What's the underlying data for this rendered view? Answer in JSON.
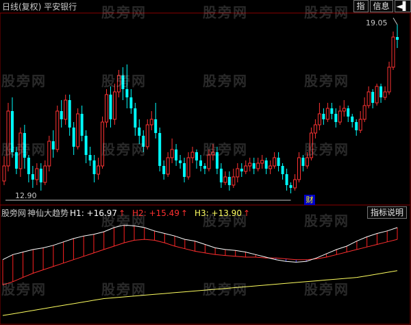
{
  "header": {
    "title": "日线(复权)  平安银行",
    "buttons": [
      "指",
      "信息"
    ],
    "window_icon": "pin-close-icon"
  },
  "watermark": "股旁网",
  "price_chart": {
    "high_label": "19.05",
    "low_label": "12.90",
    "badge": "财",
    "up_color": "#ff3333",
    "down_color": "#00ffff",
    "candles": [
      [
        13.35,
        13.9,
        13.2,
        14.25
      ],
      [
        13.9,
        15.9,
        13.7,
        16.2
      ],
      [
        15.9,
        14.4,
        14.2,
        16.4
      ],
      [
        14.4,
        13.8,
        13.6,
        14.6
      ],
      [
        13.8,
        15.1,
        13.5,
        15.3
      ],
      [
        15.1,
        14.2,
        13.8,
        15.4
      ],
      [
        14.2,
        13.6,
        13.3,
        14.3
      ],
      [
        13.6,
        13.4,
        13.1,
        13.9
      ],
      [
        13.4,
        13.8,
        13.2,
        14.0
      ],
      [
        13.8,
        13.3,
        13.0,
        14.0
      ],
      [
        13.3,
        13.9,
        13.2,
        14.1
      ],
      [
        13.9,
        14.8,
        13.7,
        15.0
      ],
      [
        14.8,
        14.5,
        14.2,
        15.2
      ],
      [
        14.5,
        15.9,
        14.4,
        16.1
      ],
      [
        15.9,
        15.6,
        15.3,
        16.3
      ],
      [
        15.6,
        16.3,
        15.4,
        16.5
      ],
      [
        16.3,
        15.3,
        15.0,
        16.5
      ],
      [
        15.3,
        14.6,
        14.3,
        15.5
      ],
      [
        14.6,
        15.8,
        14.5,
        16.0
      ],
      [
        15.8,
        15.0,
        14.8,
        16.1
      ],
      [
        15.0,
        14.3,
        14.0,
        15.2
      ],
      [
        14.3,
        14.1,
        13.9,
        14.6
      ],
      [
        14.1,
        13.6,
        13.3,
        14.3
      ],
      [
        13.6,
        13.9,
        13.4,
        14.2
      ],
      [
        13.9,
        15.5,
        13.8,
        15.7
      ],
      [
        15.5,
        16.5,
        15.3,
        16.7
      ],
      [
        16.5,
        15.6,
        15.3,
        16.8
      ],
      [
        15.6,
        16.6,
        15.4,
        16.9
      ],
      [
        16.6,
        17.2,
        16.4,
        17.4
      ],
      [
        17.2,
        16.7,
        16.3,
        17.5
      ],
      [
        16.7,
        16.4,
        16.0,
        17.6
      ],
      [
        16.4,
        16.0,
        15.8,
        16.7
      ],
      [
        16.0,
        15.3,
        15.0,
        16.2
      ],
      [
        15.3,
        15.0,
        14.7,
        15.6
      ],
      [
        15.0,
        14.6,
        14.4,
        15.2
      ],
      [
        14.6,
        15.4,
        14.5,
        15.6
      ],
      [
        15.4,
        15.6,
        15.2,
        15.9
      ],
      [
        15.6,
        15.1,
        14.9,
        16.2
      ],
      [
        15.1,
        13.9,
        13.7,
        15.3
      ],
      [
        13.9,
        13.6,
        13.4,
        14.1
      ],
      [
        13.6,
        14.2,
        13.5,
        14.4
      ],
      [
        14.2,
        14.5,
        14.0,
        14.9
      ],
      [
        14.5,
        14.1,
        13.9,
        14.7
      ],
      [
        14.1,
        14.0,
        13.8,
        14.3
      ],
      [
        14.0,
        13.5,
        13.3,
        14.2
      ],
      [
        13.5,
        14.2,
        13.4,
        14.4
      ],
      [
        14.2,
        14.4,
        14.0,
        14.6
      ],
      [
        14.4,
        14.1,
        13.8,
        14.5
      ],
      [
        14.1,
        13.9,
        13.7,
        14.3
      ],
      [
        13.9,
        13.8,
        13.6,
        14.0
      ],
      [
        13.8,
        14.3,
        13.7,
        14.5
      ],
      [
        14.3,
        14.4,
        14.1,
        14.7
      ],
      [
        14.4,
        13.8,
        13.6,
        14.6
      ],
      [
        13.8,
        13.3,
        13.1,
        14.0
      ],
      [
        13.3,
        13.5,
        13.2,
        13.7
      ],
      [
        13.5,
        13.2,
        13.0,
        13.7
      ],
      [
        13.2,
        13.5,
        13.1,
        13.8
      ],
      [
        13.5,
        13.8,
        13.3,
        14.0
      ],
      [
        13.8,
        13.7,
        13.5,
        14.0
      ],
      [
        13.7,
        13.9,
        13.6,
        14.1
      ],
      [
        13.9,
        14.0,
        13.7,
        14.2
      ],
      [
        14.0,
        13.8,
        13.6,
        14.2
      ],
      [
        13.8,
        14.0,
        13.7,
        14.2
      ],
      [
        14.0,
        14.1,
        13.8,
        14.3
      ],
      [
        14.1,
        13.8,
        13.6,
        14.2
      ],
      [
        13.8,
        13.9,
        13.6,
        14.1
      ],
      [
        13.9,
        14.2,
        13.8,
        14.4
      ],
      [
        14.2,
        13.9,
        13.7,
        14.4
      ],
      [
        13.9,
        13.6,
        13.4,
        14.0
      ],
      [
        13.6,
        13.2,
        13.0,
        13.8
      ],
      [
        13.2,
        13.1,
        12.9,
        13.3
      ],
      [
        13.1,
        13.4,
        13.0,
        13.6
      ],
      [
        13.4,
        14.2,
        13.3,
        14.4
      ],
      [
        14.2,
        13.9,
        13.7,
        14.3
      ],
      [
        13.9,
        14.2,
        13.8,
        14.4
      ],
      [
        14.2,
        15.1,
        14.1,
        15.3
      ],
      [
        15.1,
        15.4,
        14.9,
        15.6
      ],
      [
        15.4,
        15.8,
        15.2,
        16.2
      ],
      [
        15.8,
        15.6,
        15.4,
        16.0
      ],
      [
        15.6,
        16.0,
        15.5,
        16.2
      ],
      [
        16.0,
        15.8,
        15.6,
        16.2
      ],
      [
        15.8,
        15.5,
        15.3,
        16.0
      ],
      [
        15.5,
        15.9,
        15.4,
        16.1
      ],
      [
        15.9,
        16.0,
        15.7,
        16.3
      ],
      [
        16.0,
        15.7,
        15.5,
        16.1
      ],
      [
        15.7,
        15.5,
        15.3,
        15.8
      ],
      [
        15.5,
        15.2,
        15.0,
        15.6
      ],
      [
        15.2,
        15.6,
        15.1,
        15.9
      ],
      [
        15.6,
        16.1,
        15.5,
        16.4
      ],
      [
        16.1,
        16.6,
        16.0,
        16.8
      ],
      [
        16.6,
        16.2,
        16.0,
        16.7
      ],
      [
        16.2,
        16.8,
        16.1,
        16.9
      ],
      [
        16.8,
        16.4,
        16.2,
        16.9
      ],
      [
        16.4,
        16.6,
        16.3,
        16.8
      ],
      [
        16.6,
        17.5,
        16.5,
        17.7
      ],
      [
        17.5,
        18.6,
        17.4,
        18.8
      ],
      [
        18.6,
        18.5,
        18.2,
        19.05
      ]
    ]
  },
  "indicator": {
    "name": "神仙大趋势",
    "h1_label": "H1: +16.97",
    "h2_label": "H2: +15.49",
    "h3_label": "H3: +13.90",
    "arrow": "↑",
    "explain_button": "指标说明",
    "h1_color": "#ffffff",
    "h2_color": "#ff3030",
    "h3_color": "#ffff60",
    "h1": [
      16.3,
      16.6,
      16.75,
      16.9,
      17.0,
      17.15,
      17.35,
      17.55,
      17.7,
      17.8,
      17.95,
      18.2,
      18.35,
      18.3,
      18.2,
      18.0,
      17.85,
      17.7,
      17.5,
      17.4,
      17.2,
      17.0,
      16.9,
      16.85,
      16.75,
      16.6,
      16.45,
      16.3,
      16.2,
      16.15,
      16.2,
      16.4,
      16.65,
      16.9,
      17.1,
      17.4,
      17.65,
      17.85,
      18.0,
      18.2
    ],
    "h2": [
      14.8,
      15.0,
      15.25,
      15.5,
      15.7,
      15.9,
      16.1,
      16.3,
      16.5,
      16.7,
      16.9,
      17.1,
      17.3,
      17.45,
      17.5,
      17.45,
      17.3,
      17.1,
      16.95,
      16.8,
      16.7,
      16.6,
      16.55,
      16.5,
      16.45,
      16.45,
      16.4,
      16.4,
      16.35,
      16.3,
      16.3,
      16.35,
      16.45,
      16.6,
      16.75,
      16.9,
      17.05,
      17.2,
      17.35,
      17.5
    ],
    "h3": [
      13.0,
      13.1,
      13.2,
      13.3,
      13.4,
      13.5,
      13.6,
      13.7,
      13.8,
      13.9,
      14.0,
      14.05,
      14.1,
      14.15,
      14.2,
      14.25,
      14.3,
      14.35,
      14.4,
      14.45,
      14.5,
      14.55,
      14.6,
      14.65,
      14.7,
      14.75,
      14.8,
      14.85,
      14.9,
      14.95,
      15.0,
      15.05,
      15.1,
      15.15,
      15.2,
      15.25,
      15.35,
      15.45,
      15.55,
      15.65
    ]
  }
}
